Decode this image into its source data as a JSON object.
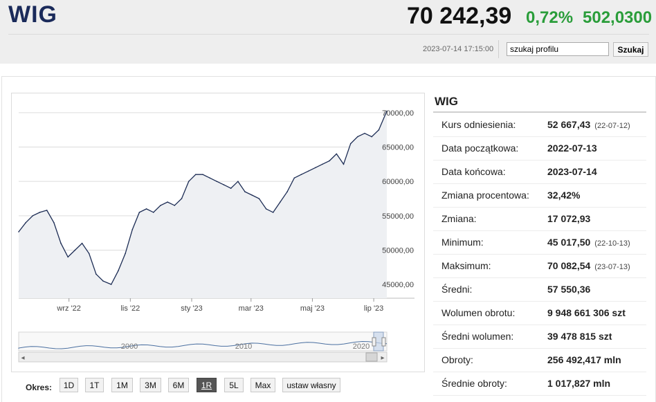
{
  "header": {
    "title": "WIG",
    "price": "70 242,39",
    "change_pct": "0,72%",
    "change_abs": "502,0300",
    "timestamp": "2023-07-14 17:15:00",
    "search_value": "szukaj profilu",
    "search_button": "Szukaj",
    "accent_color": "#2a9d3a",
    "title_color": "#1a2a5a"
  },
  "chart_data": {
    "type": "area",
    "title": "",
    "x": [
      "2022-07-13",
      "2022-07-20",
      "2022-07-27",
      "2022-08-03",
      "2022-08-10",
      "2022-08-17",
      "2022-08-24",
      "2022-08-31",
      "2022-09-07",
      "2022-09-14",
      "2022-09-21",
      "2022-09-28",
      "2022-10-05",
      "2022-10-13",
      "2022-10-20",
      "2022-10-27",
      "2022-11-03",
      "2022-11-10",
      "2022-11-17",
      "2022-11-24",
      "2022-12-01",
      "2022-12-08",
      "2022-12-15",
      "2022-12-22",
      "2022-12-29",
      "2023-01-05",
      "2023-01-12",
      "2023-01-19",
      "2023-01-26",
      "2023-02-02",
      "2023-02-09",
      "2023-02-16",
      "2023-02-23",
      "2023-03-02",
      "2023-03-09",
      "2023-03-16",
      "2023-03-23",
      "2023-03-30",
      "2023-04-06",
      "2023-04-13",
      "2023-04-20",
      "2023-04-27",
      "2023-05-04",
      "2023-05-11",
      "2023-05-18",
      "2023-05-25",
      "2023-06-01",
      "2023-06-08",
      "2023-06-15",
      "2023-06-22",
      "2023-06-29",
      "2023-07-06",
      "2023-07-14"
    ],
    "series": [
      {
        "values": [
          52667,
          54000,
          55000,
          55500,
          55800,
          54000,
          51000,
          49000,
          50000,
          51000,
          49500,
          46500,
          45500,
          45017,
          47000,
          49500,
          53000,
          55500,
          56000,
          55500,
          56500,
          57000,
          56500,
          57500,
          60000,
          61000,
          61000,
          60500,
          60000,
          59500,
          59000,
          60000,
          58500,
          58000,
          57500,
          56000,
          55500,
          57000,
          58500,
          60500,
          61000,
          61500,
          62000,
          62500,
          63000,
          64000,
          62500,
          65500,
          66500,
          67000,
          66500,
          67500,
          70242
        ]
      }
    ],
    "y_ticks": [
      "45000,00",
      "50000,00",
      "55000,00",
      "60000,00",
      "65000,00",
      "70000,00"
    ],
    "ylim": [
      43000,
      72000
    ],
    "x_ticks": [
      {
        "label": "wrz '22",
        "date": "2022-09-01"
      },
      {
        "label": "lis '22",
        "date": "2022-11-01"
      },
      {
        "label": "sty '23",
        "date": "2023-01-01"
      },
      {
        "label": "mar '23",
        "date": "2023-03-01"
      },
      {
        "label": "maj '23",
        "date": "2023-05-01"
      },
      {
        "label": "lip '23",
        "date": "2023-07-01"
      }
    ],
    "navigator_labels": [
      "2000",
      "2010",
      "2020"
    ],
    "grid": true,
    "line_color": "#1c2c54",
    "fill_color": "#eef0f3"
  },
  "period": {
    "label": "Okres:",
    "buttons": [
      "1D",
      "1T",
      "1M",
      "3M",
      "6M",
      "1R",
      "5L",
      "Max",
      "ustaw własny"
    ],
    "active": "1R"
  },
  "panel": {
    "title": "WIG",
    "rows": [
      {
        "key": "Kurs odniesienia:",
        "value": "52 667,43",
        "date": "(22-07-12)"
      },
      {
        "key": "Data początkowa:",
        "value": "2022-07-13",
        "date": ""
      },
      {
        "key": "Data końcowa:",
        "value": "2023-07-14",
        "date": ""
      },
      {
        "key": "Zmiana procentowa:",
        "value": "32,42%",
        "date": ""
      },
      {
        "key": "Zmiana:",
        "value": "17 072,93",
        "date": ""
      },
      {
        "key": "Minimum:",
        "value": "45 017,50",
        "date": "(22-10-13)"
      },
      {
        "key": "Maksimum:",
        "value": "70 082,54",
        "date": "(23-07-13)"
      },
      {
        "key": "Średni:",
        "value": "57 550,36",
        "date": ""
      },
      {
        "key": "Wolumen obrotu:",
        "value": "9 948 661 306 szt",
        "date": ""
      },
      {
        "key": "Średni wolumen:",
        "value": "39 478 815 szt",
        "date": ""
      },
      {
        "key": "Obroty:",
        "value": "256 492,417 mln",
        "date": ""
      },
      {
        "key": "Średnie obroty:",
        "value": "1 017,827 mln",
        "date": ""
      }
    ]
  }
}
